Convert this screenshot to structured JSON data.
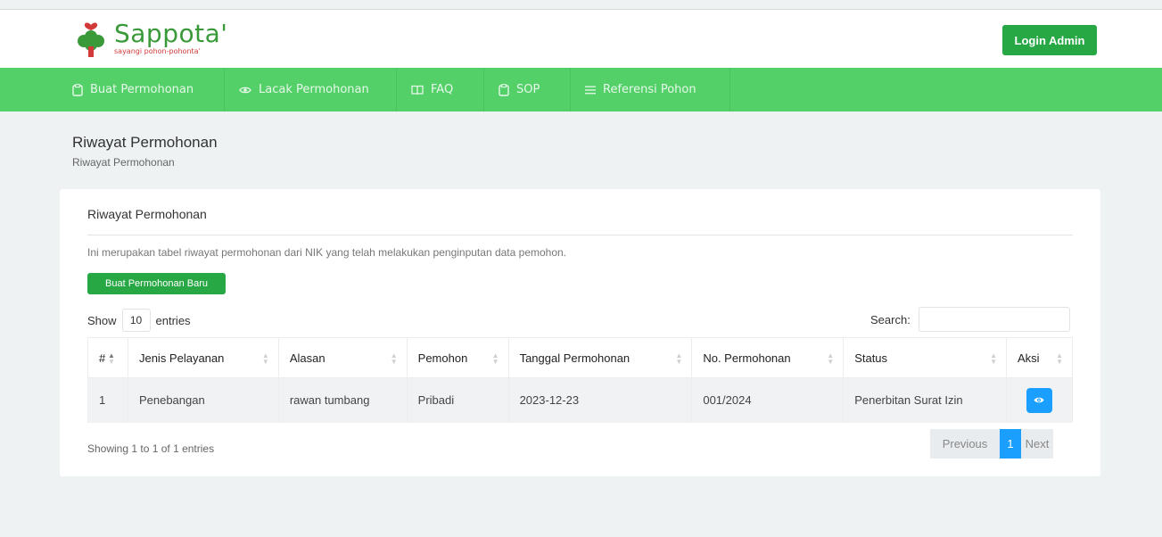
{
  "brand": {
    "name": "Sappota'",
    "tagline": "sayangi pohon-pohonta'",
    "green": "#3a9a3a",
    "red": "#d23a3a"
  },
  "header": {
    "login_label": "Login Admin"
  },
  "nav": {
    "items": [
      {
        "label": "Buat Permohonan",
        "icon": "clipboard-icon"
      },
      {
        "label": "Lacak Permohonan",
        "icon": "eye-icon"
      },
      {
        "label": "FAQ",
        "icon": "book-icon"
      },
      {
        "label": "SOP",
        "icon": "clipboard-icon"
      },
      {
        "label": "Referensi Pohon",
        "icon": "list-icon"
      }
    ],
    "color": "#54d068"
  },
  "page": {
    "title": "Riwayat Permohonan",
    "breadcrumb": "Riwayat Permohonan"
  },
  "card": {
    "title": "Riwayat Permohonan",
    "description": "Ini merupakan tabel riwayat permohonan dari NIK yang telah melakukan penginputan data pemohon.",
    "new_button": "Buat Permohonan Baru"
  },
  "table": {
    "show_label": "Show",
    "entries_value": "10",
    "entries_label": "entries",
    "search_label": "Search:",
    "search_placeholder": "",
    "columns": [
      "#",
      "Jenis Pelayanan",
      "Alasan",
      "Pemohon",
      "Tanggal Permohonan",
      "No. Permohonan",
      "Status",
      "Aksi"
    ],
    "rows": [
      [
        "1",
        "Penebangan",
        "rawan tumbang",
        "Pribadi",
        "2023-12-23",
        "001/2024",
        "Penerbitan Surat Izin"
      ]
    ],
    "action_icon": "eye-icon",
    "info": "Showing 1 to 1 of 1 entries",
    "pagination": {
      "previous": "Previous",
      "current": "1",
      "next": "Next"
    }
  }
}
